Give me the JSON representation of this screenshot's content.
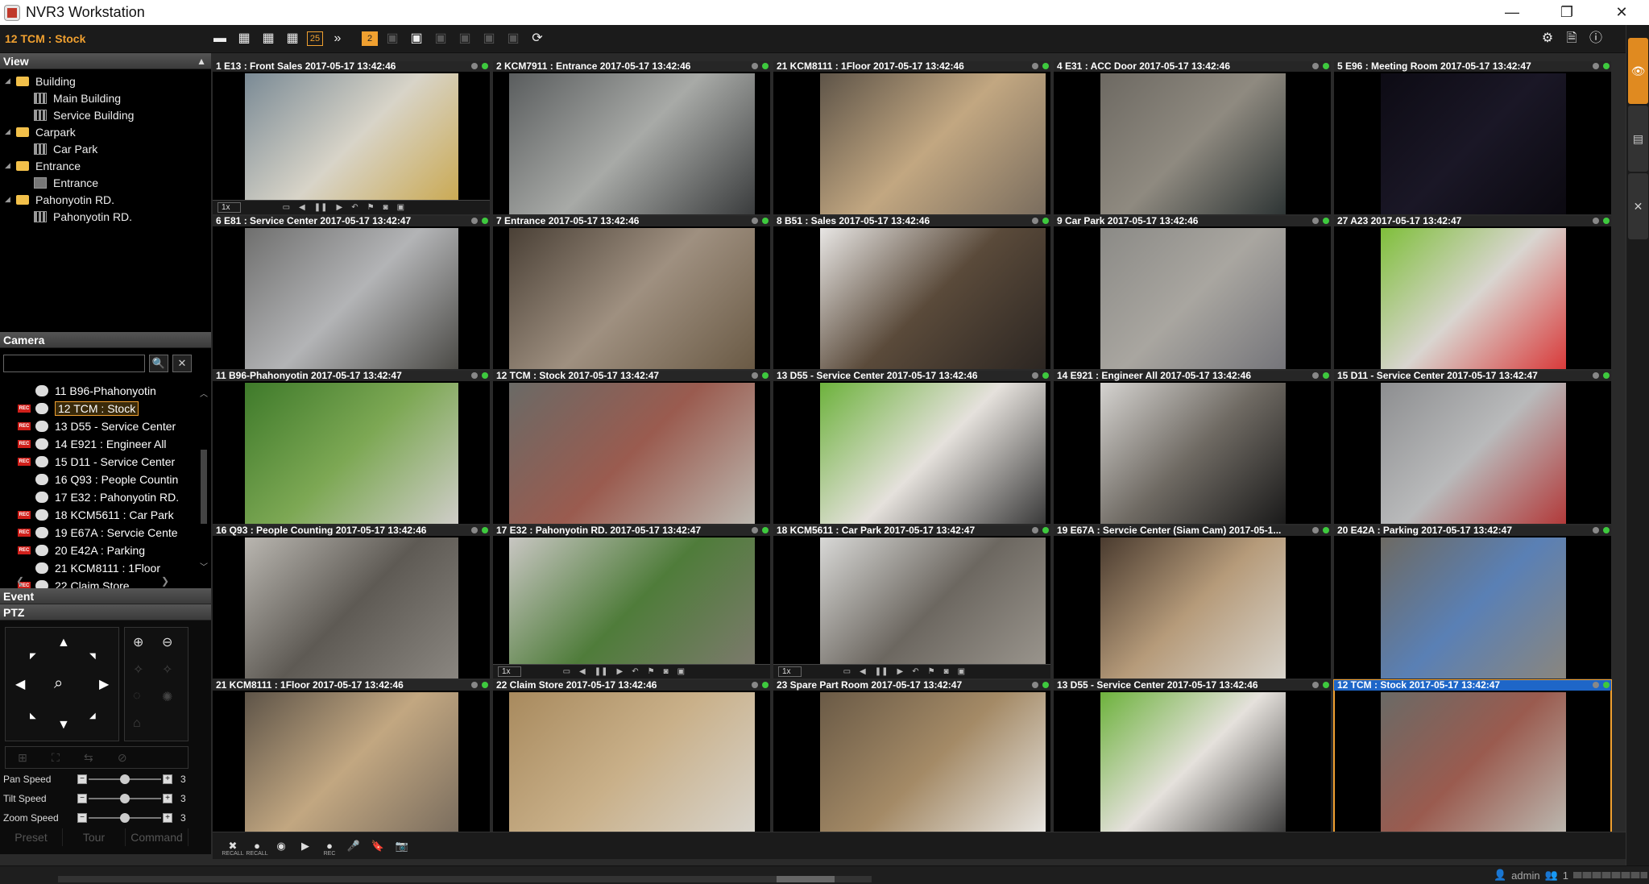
{
  "window": {
    "title": "NVR3 Workstation",
    "min": "—",
    "max": "❐",
    "close": "✕"
  },
  "toolbar": {
    "current_camera": "12 TCM : Stock",
    "layouts": [
      "▬",
      "▦",
      "▦",
      "▦",
      "25",
      "»"
    ],
    "page_badge": "2",
    "icons": [
      "▣",
      "▣",
      "▣",
      "▣",
      "▣",
      "▣",
      "⟳"
    ],
    "right_icons": [
      "⚙",
      "🗎",
      "ⓘ"
    ]
  },
  "view_panel": {
    "title": "View",
    "tree": [
      {
        "label": "Building",
        "type": "folder",
        "level": 0
      },
      {
        "label": "Main Building",
        "type": "layout",
        "level": 1
      },
      {
        "label": "Service Building",
        "type": "layout",
        "level": 1
      },
      {
        "label": "Carpark",
        "type": "folder",
        "level": 0
      },
      {
        "label": "Car Park",
        "type": "layout",
        "level": 1
      },
      {
        "label": "Entrance",
        "type": "folder",
        "level": 0
      },
      {
        "label": "Entrance",
        "type": "single",
        "level": 1
      },
      {
        "label": "Pahonyotin RD.",
        "type": "folder",
        "level": 0
      },
      {
        "label": "Pahonyotin RD.",
        "type": "layout",
        "level": 1
      }
    ]
  },
  "camera_panel": {
    "title": "Camera",
    "search_placeholder": "",
    "search_icon": "🔍",
    "clear_icon": "✕",
    "rec_label": "REC",
    "cameras": [
      {
        "label": "11 B96-Phahonyotin",
        "rec": false,
        "selected": false
      },
      {
        "label": "12 TCM : Stock",
        "rec": true,
        "selected": true
      },
      {
        "label": "13 D55 - Service Center",
        "rec": true,
        "selected": false
      },
      {
        "label": "14 E921 : Engineer All",
        "rec": true,
        "selected": false
      },
      {
        "label": "15 D11 - Service Center",
        "rec": true,
        "selected": false
      },
      {
        "label": "16 Q93 : People Countin",
        "rec": false,
        "selected": false
      },
      {
        "label": "17 E32 : Pahonyotin RD.",
        "rec": false,
        "selected": false
      },
      {
        "label": "18 KCM5611 : Car Park",
        "rec": true,
        "selected": false
      },
      {
        "label": "19 E67A : Servcie Cente",
        "rec": true,
        "selected": false
      },
      {
        "label": "20 E42A : Parking",
        "rec": true,
        "selected": false
      },
      {
        "label": "21 KCM8111 : 1Floor",
        "rec": false,
        "selected": false
      },
      {
        "label": "22 Claim Store",
        "rec": true,
        "selected": false
      }
    ]
  },
  "event_panel": {
    "title": "Event"
  },
  "ptz_panel": {
    "title": "PTZ",
    "speeds": [
      {
        "label": "Pan Speed",
        "value": "3",
        "level": 0.5
      },
      {
        "label": "Tilt Speed",
        "value": "3",
        "level": 0.5
      },
      {
        "label": "Zoom Speed",
        "value": "3",
        "level": 0.5
      }
    ],
    "tabs": [
      "Preset",
      "Tour",
      "Command"
    ]
  },
  "grid": {
    "tiles": [
      {
        "title": "1 E13 : Front Sales   2017-05-17 13:42:46",
        "colors": [
          "#7a8a95",
          "#d8d4c8",
          "#c9a64a"
        ],
        "controls": true
      },
      {
        "title": "2 KCM7911 : Entrance   2017-05-17 13:42:46",
        "colors": [
          "#5a5d5e",
          "#a8aaa7",
          "#3a3c3d"
        ],
        "controls": false
      },
      {
        "title": "21 KCM8111 : 1Floor   2017-05-17 13:42:46",
        "colors": [
          "#5e5448",
          "#c2a781",
          "#7a6d5e"
        ],
        "controls": false
      },
      {
        "title": "4 E31 : ACC Door   2017-05-17 13:42:46",
        "colors": [
          "#6d6962",
          "#8f8a80",
          "#2e3535"
        ],
        "controls": false
      },
      {
        "title": "5 E96 : Meeting Room   2017-05-17 13:42:47",
        "colors": [
          "#0d0b14",
          "#1a1726",
          "#0b0910"
        ],
        "controls": false
      },
      {
        "title": "6 E81 : Service Center   2017-05-17 13:42:47",
        "colors": [
          "#6f6f6e",
          "#b3b4b6",
          "#4b4a46"
        ],
        "controls": false
      },
      {
        "title": "7 Entrance   2017-05-17 13:42:46",
        "colors": [
          "#4a4036",
          "#9f9080",
          "#6a5a45"
        ],
        "controls": false
      },
      {
        "title": "8 B51 : Sales   2017-05-17 13:42:46",
        "colors": [
          "#e8e6e4",
          "#5a4a3a",
          "#2c2622"
        ],
        "controls": false
      },
      {
        "title": "9 Car Park   2017-05-17 13:42:46",
        "colors": [
          "#8b8a86",
          "#a9a6a0",
          "#75757a"
        ],
        "controls": false
      },
      {
        "title": "27 A23   2017-05-17 13:42:47",
        "colors": [
          "#7fbf3a",
          "#d9d5d0",
          "#d93a3a"
        ],
        "controls": false
      },
      {
        "title": "11 B96-Phahonyotin   2017-05-17 13:42:47",
        "colors": [
          "#3e7a2a",
          "#7da854",
          "#cfcdc8"
        ],
        "controls": false
      },
      {
        "title": "12 TCM : Stock   2017-05-17 13:42:47",
        "colors": [
          "#6a6a66",
          "#9a5b4f",
          "#bcb8b0"
        ],
        "controls": false
      },
      {
        "title": "13 D55 - Service Center   2017-05-17 13:42:46",
        "colors": [
          "#6db23c",
          "#e5e1dc",
          "#3a3a3a"
        ],
        "controls": false
      },
      {
        "title": "14 E921 : Engineer All   2017-05-17 13:42:46",
        "colors": [
          "#d5d3d0",
          "#6f6a63",
          "#1a1a1a"
        ],
        "controls": false
      },
      {
        "title": "15 D11 - Service Center   2017-05-17 13:42:47",
        "colors": [
          "#8d8e90",
          "#b9babb",
          "#b23a3a"
        ],
        "controls": false
      },
      {
        "title": "16 Q93 : People Counting   2017-05-17 13:42:46",
        "colors": [
          "#b9b6b0",
          "#5e5a54",
          "#8a8680"
        ],
        "controls": false
      },
      {
        "title": "17 E32 : Pahonyotin RD.   2017-05-17 13:42:47",
        "colors": [
          "#c8c6c2",
          "#4f7c3a",
          "#7f7a70"
        ],
        "controls": true
      },
      {
        "title": "18 KCM5611 : Car Park   2017-05-17 13:42:47",
        "colors": [
          "#d8d8d6",
          "#6c6760",
          "#9d9890"
        ],
        "controls": true
      },
      {
        "title": "19 E67A : Servcie Center (Siam Cam)   2017-05-1...",
        "colors": [
          "#4a3b2f",
          "#b69b7a",
          "#d8d4cc"
        ],
        "controls": false
      },
      {
        "title": "20 E42A : Parking   2017-05-17 13:42:47",
        "colors": [
          "#6d6a63",
          "#5a80b5",
          "#8a867e"
        ],
        "controls": false
      },
      {
        "title": "21 KCM8111 : 1Floor   2017-05-17 13:42:46",
        "colors": [
          "#5e5448",
          "#c2a781",
          "#7a6d5e"
        ],
        "controls": false
      },
      {
        "title": "22 Claim Store   2017-05-17 13:42:46",
        "colors": [
          "#a88a5e",
          "#c9b089",
          "#d8d4cc"
        ],
        "controls": false
      },
      {
        "title": "23 Spare Part Room   2017-05-17 13:42:47",
        "colors": [
          "#6a5a46",
          "#a48a66",
          "#e8e6e2"
        ],
        "controls": false
      },
      {
        "title": "13 D55 - Service Center   2017-05-17 13:42:46",
        "colors": [
          "#6db23c",
          "#e5e1dc",
          "#3a3a3a"
        ],
        "controls": false
      },
      {
        "title": "12 TCM : Stock   2017-05-17 13:42:47",
        "colors": [
          "#6a6a66",
          "#9a5b4f",
          "#bcb8b0"
        ],
        "controls": false,
        "active": true
      }
    ],
    "control_speed": "1x"
  },
  "bottombar": {
    "buttons": [
      {
        "icon": "✖",
        "label": "RECALL"
      },
      {
        "icon": "●",
        "label": "RECALL"
      },
      {
        "icon": "◉",
        "label": ""
      },
      {
        "icon": "▶",
        "label": ""
      },
      {
        "icon": "●",
        "label": "REC"
      },
      {
        "icon": "🎤",
        "label": ""
      },
      {
        "icon": "🔖",
        "label": ""
      },
      {
        "icon": "📷",
        "label": ""
      }
    ]
  },
  "statusbar": {
    "user": "admin",
    "count": "1"
  }
}
